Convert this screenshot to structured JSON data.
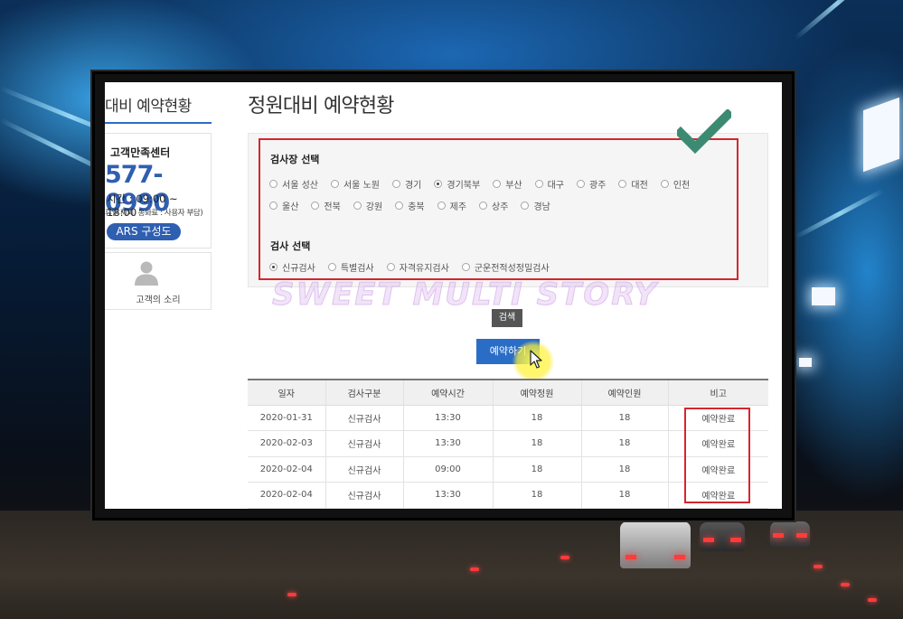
{
  "sidebar": {
    "section_title": "대비 예약현황",
    "customer_center": {
      "label": "고객만족센터",
      "phone": "577-0990",
      "hours": "시간 : 09:00 ~ 18:00",
      "note": "휴일 제외, 통화료 : 사용자 부담)",
      "ars_button": "ARS 구성도"
    },
    "voice": {
      "label": "고객의 소리",
      "icon": "person-icon"
    }
  },
  "main": {
    "title": "정원대비 예약현황",
    "site_group": {
      "title": "검사장 선택",
      "options": [
        "서울 성산",
        "서울 노원",
        "경기",
        "경기북부",
        "부산",
        "대구",
        "광주",
        "대전",
        "인천",
        "울산",
        "전북",
        "강원",
        "충북",
        "제주",
        "상주",
        "경남"
      ],
      "selected": "경기북부"
    },
    "type_group": {
      "title": "검사 선택",
      "options": [
        "신규검사",
        "특별검사",
        "자격유지검사",
        "군운전적성정밀검사"
      ],
      "selected": "신규검사"
    },
    "search_label": "검색",
    "reserve_label": "예약하기",
    "watermark": "SWEET MULTI STORY",
    "table": {
      "headers": [
        "일자",
        "검사구분",
        "예약시간",
        "예약정원",
        "예약인원",
        "비고"
      ],
      "rows": [
        [
          "2020-01-31",
          "신규검사",
          "13:30",
          "18",
          "18",
          "예약완료"
        ],
        [
          "2020-02-03",
          "신규검사",
          "13:30",
          "18",
          "18",
          "예약완료"
        ],
        [
          "2020-02-04",
          "신규검사",
          "09:00",
          "18",
          "18",
          "예약완료"
        ],
        [
          "2020-02-04",
          "신규검사",
          "13:30",
          "18",
          "18",
          "예약완료"
        ]
      ]
    }
  },
  "colors": {
    "accent": "#2f5fb0",
    "highlight": "#d4262d",
    "check": "#3d8a72"
  }
}
